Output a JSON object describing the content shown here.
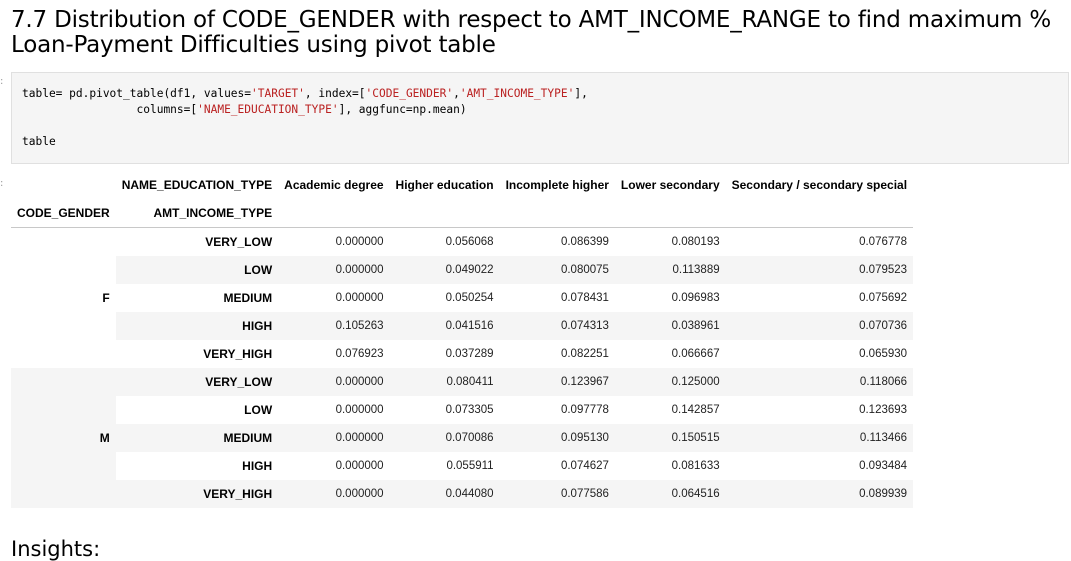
{
  "heading": "7.7 Distribution of CODE_GENDER with respect to AMT_INCOME_RANGE to find maximum % Loan-Payment Difficulties using pivot table",
  "code": {
    "line1_a": "table= pd.pivot_table(df1, values=",
    "line1_s1": "'TARGET'",
    "line1_b": ", index=[",
    "line1_s2": "'CODE_GENDER'",
    "line1_c": ",",
    "line1_s3": "'AMT_INCOME_TYPE'",
    "line1_d": "],",
    "line2_a": "                 columns=[",
    "line2_s1": "'NAME_EDUCATION_TYPE'",
    "line2_b": "], aggfunc=np.mean)",
    "line3": "table"
  },
  "table": {
    "columns_level_name": "NAME_EDUCATION_TYPE",
    "columns": [
      "Academic degree",
      "Higher education",
      "Incomplete higher",
      "Lower secondary",
      "Secondary / secondary special"
    ],
    "index_names": [
      "CODE_GENDER",
      "AMT_INCOME_TYPE"
    ],
    "groups": [
      {
        "gender": "F",
        "rows": [
          {
            "income": "VERY_LOW",
            "values": [
              "0.000000",
              "0.056068",
              "0.086399",
              "0.080193",
              "0.076778"
            ]
          },
          {
            "income": "LOW",
            "values": [
              "0.000000",
              "0.049022",
              "0.080075",
              "0.113889",
              "0.079523"
            ]
          },
          {
            "income": "MEDIUM",
            "values": [
              "0.000000",
              "0.050254",
              "0.078431",
              "0.096983",
              "0.075692"
            ]
          },
          {
            "income": "HIGH",
            "values": [
              "0.105263",
              "0.041516",
              "0.074313",
              "0.038961",
              "0.070736"
            ]
          },
          {
            "income": "VERY_HIGH",
            "values": [
              "0.076923",
              "0.037289",
              "0.082251",
              "0.066667",
              "0.065930"
            ]
          }
        ]
      },
      {
        "gender": "M",
        "rows": [
          {
            "income": "VERY_LOW",
            "values": [
              "0.000000",
              "0.080411",
              "0.123967",
              "0.125000",
              "0.118066"
            ]
          },
          {
            "income": "LOW",
            "values": [
              "0.000000",
              "0.073305",
              "0.097778",
              "0.142857",
              "0.123693"
            ]
          },
          {
            "income": "MEDIUM",
            "values": [
              "0.000000",
              "0.070086",
              "0.095130",
              "0.150515",
              "0.113466"
            ]
          },
          {
            "income": "HIGH",
            "values": [
              "0.000000",
              "0.055911",
              "0.074627",
              "0.081633",
              "0.093484"
            ]
          },
          {
            "income": "VERY_HIGH",
            "values": [
              "0.000000",
              "0.044080",
              "0.077586",
              "0.064516",
              "0.089939"
            ]
          }
        ]
      }
    ]
  },
  "insights_heading": "Insights:"
}
